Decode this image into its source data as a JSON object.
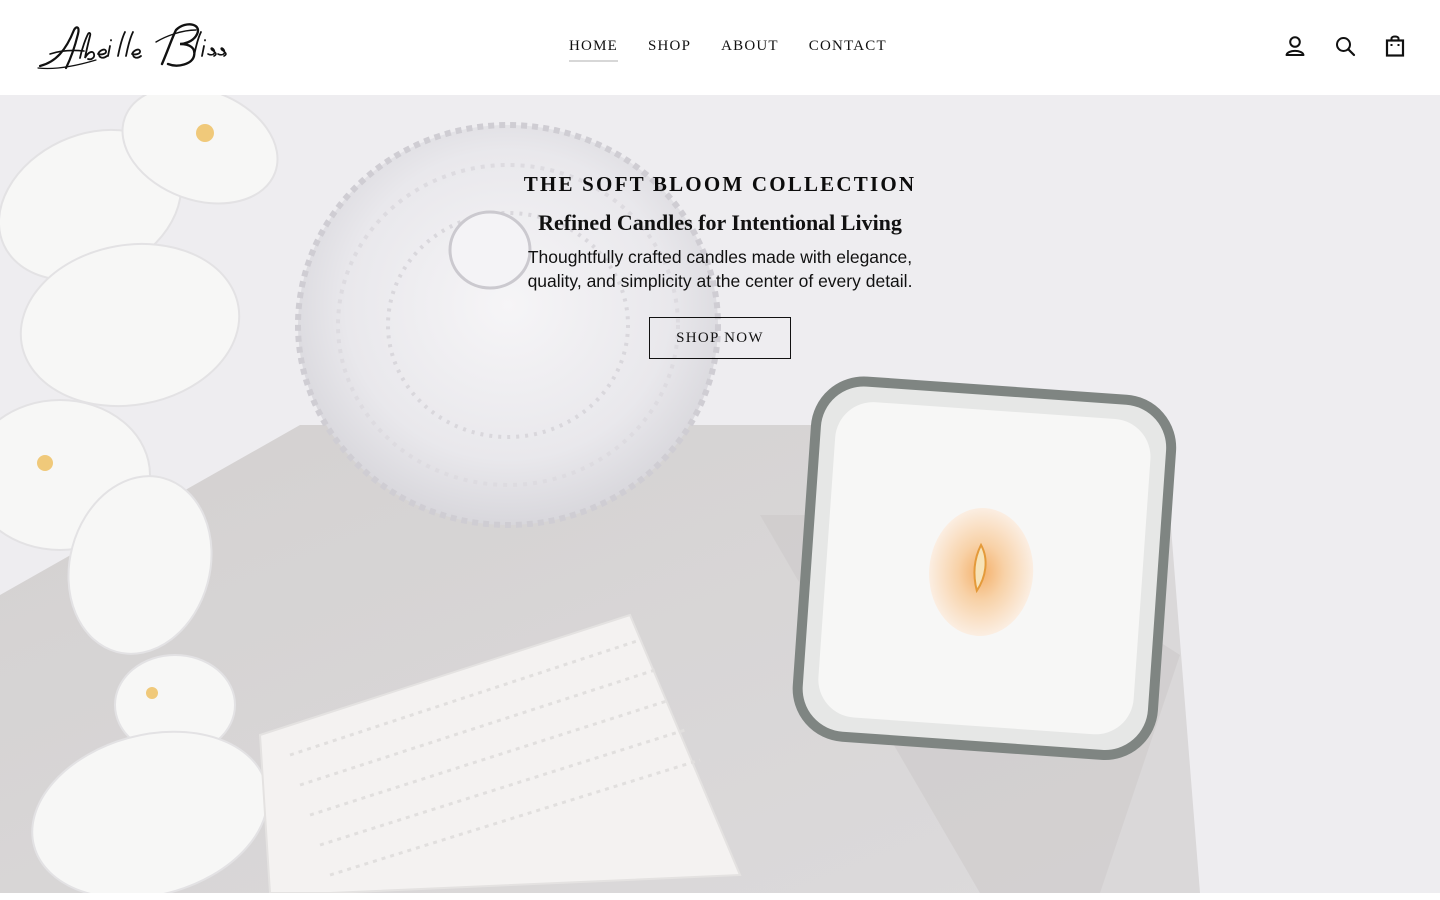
{
  "brand": {
    "logo_text": "Abeille Bliss",
    "logo_icon": "brand-wordmark"
  },
  "nav": {
    "items": [
      {
        "label": "HOME",
        "active": true
      },
      {
        "label": "SHOP",
        "active": false
      },
      {
        "label": "ABOUT",
        "active": false
      },
      {
        "label": "CONTACT",
        "active": false
      }
    ]
  },
  "header_icons": {
    "account": "account-icon",
    "search": "search-icon",
    "cart": "cart-bag-icon"
  },
  "hero": {
    "title": "THE SOFT BLOOM COLLECTION",
    "subtitle": "Refined Candles for Intentional Living",
    "description": "Thoughtfully crafted candles made with elegance, quality, and simplicity at the center of every detail.",
    "cta_label": "SHOP NOW",
    "image_subject": "hero-candle-photo"
  },
  "colors": {
    "header_bg": "#ffffff",
    "hero_bg": "#eeedf0",
    "text": "#111111",
    "nav_underline": "#d7d7d7",
    "flame": "#f0a860"
  }
}
